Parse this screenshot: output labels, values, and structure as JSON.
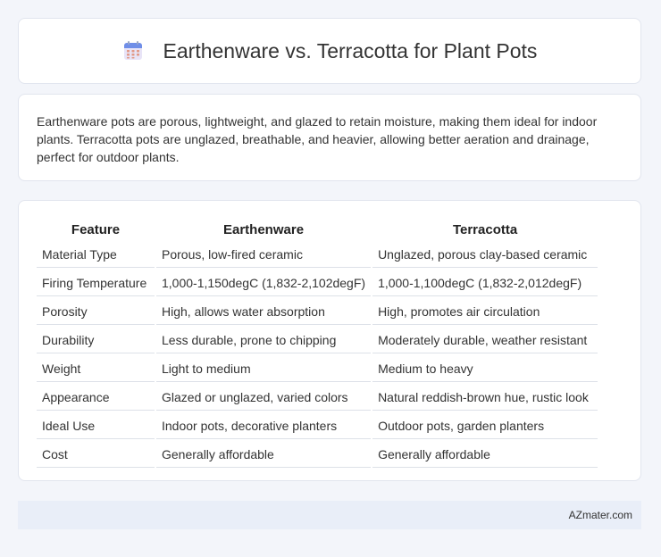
{
  "header": {
    "title": "Earthenware vs. Terracotta for Plant Pots",
    "icon": "calendar-icon"
  },
  "description": "Earthenware pots are porous, lightweight, and glazed to retain moisture, making them ideal for indoor plants. Terracotta pots are unglazed, breathable, and heavier, allowing better aeration and drainage, perfect for outdoor plants.",
  "table": {
    "headers": [
      "Feature",
      "Earthenware",
      "Terracotta"
    ],
    "rows": [
      [
        "Material Type",
        "Porous, low-fired ceramic",
        "Unglazed, porous clay-based ceramic"
      ],
      [
        "Firing Temperature",
        "1,000-1,150degC (1,832-2,102degF)",
        "1,000-1,100degC (1,832-2,012degF)"
      ],
      [
        "Porosity",
        "High, allows water absorption",
        "High, promotes air circulation"
      ],
      [
        "Durability",
        "Less durable, prone to chipping",
        "Moderately durable, weather resistant"
      ],
      [
        "Weight",
        "Light to medium",
        "Medium to heavy"
      ],
      [
        "Appearance",
        "Glazed or unglazed, varied colors",
        "Natural reddish-brown hue, rustic look"
      ],
      [
        "Ideal Use",
        "Indoor pots, decorative planters",
        "Outdoor pots, garden planters"
      ],
      [
        "Cost",
        "Generally affordable",
        "Generally affordable"
      ]
    ]
  },
  "footer": {
    "brand": "AZmater.com"
  }
}
